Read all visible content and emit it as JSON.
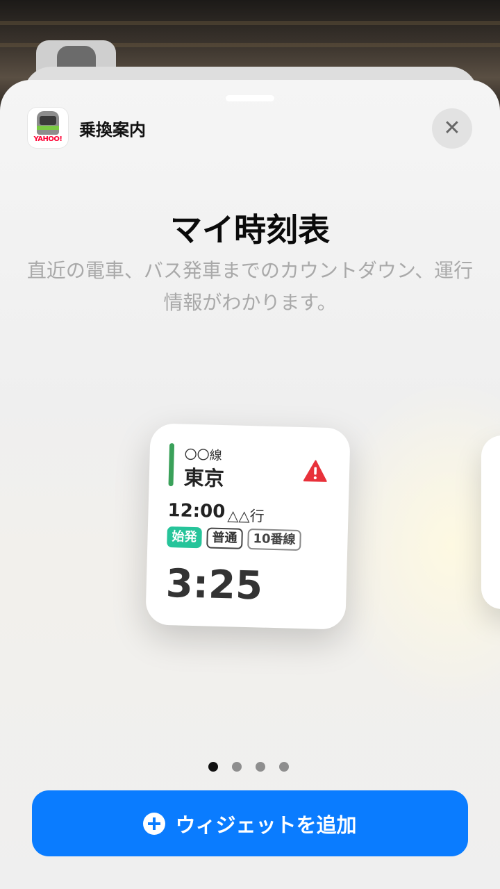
{
  "app": {
    "name": "乗換案内",
    "icon_name": "yahoo-transit-train-icon",
    "logo_text": "YAHOO!"
  },
  "widget_info": {
    "title": "マイ時刻表",
    "description": "直近の電車、バス発車までのカウントダウン、運行情報がわかります。"
  },
  "widget_preview": {
    "line_name": "〇〇線",
    "station": "東京",
    "departure_time": "12:00",
    "destination": "△△行",
    "badges": [
      "始発",
      "普通",
      "10番線"
    ],
    "countdown": "3:25",
    "line_color": "#3aa15a",
    "alert_color": "#e8313a"
  },
  "pagination": {
    "total": 4,
    "active_index": 0
  },
  "add_button": {
    "label": "ウィジェットを追加",
    "color": "#0a7cff"
  }
}
